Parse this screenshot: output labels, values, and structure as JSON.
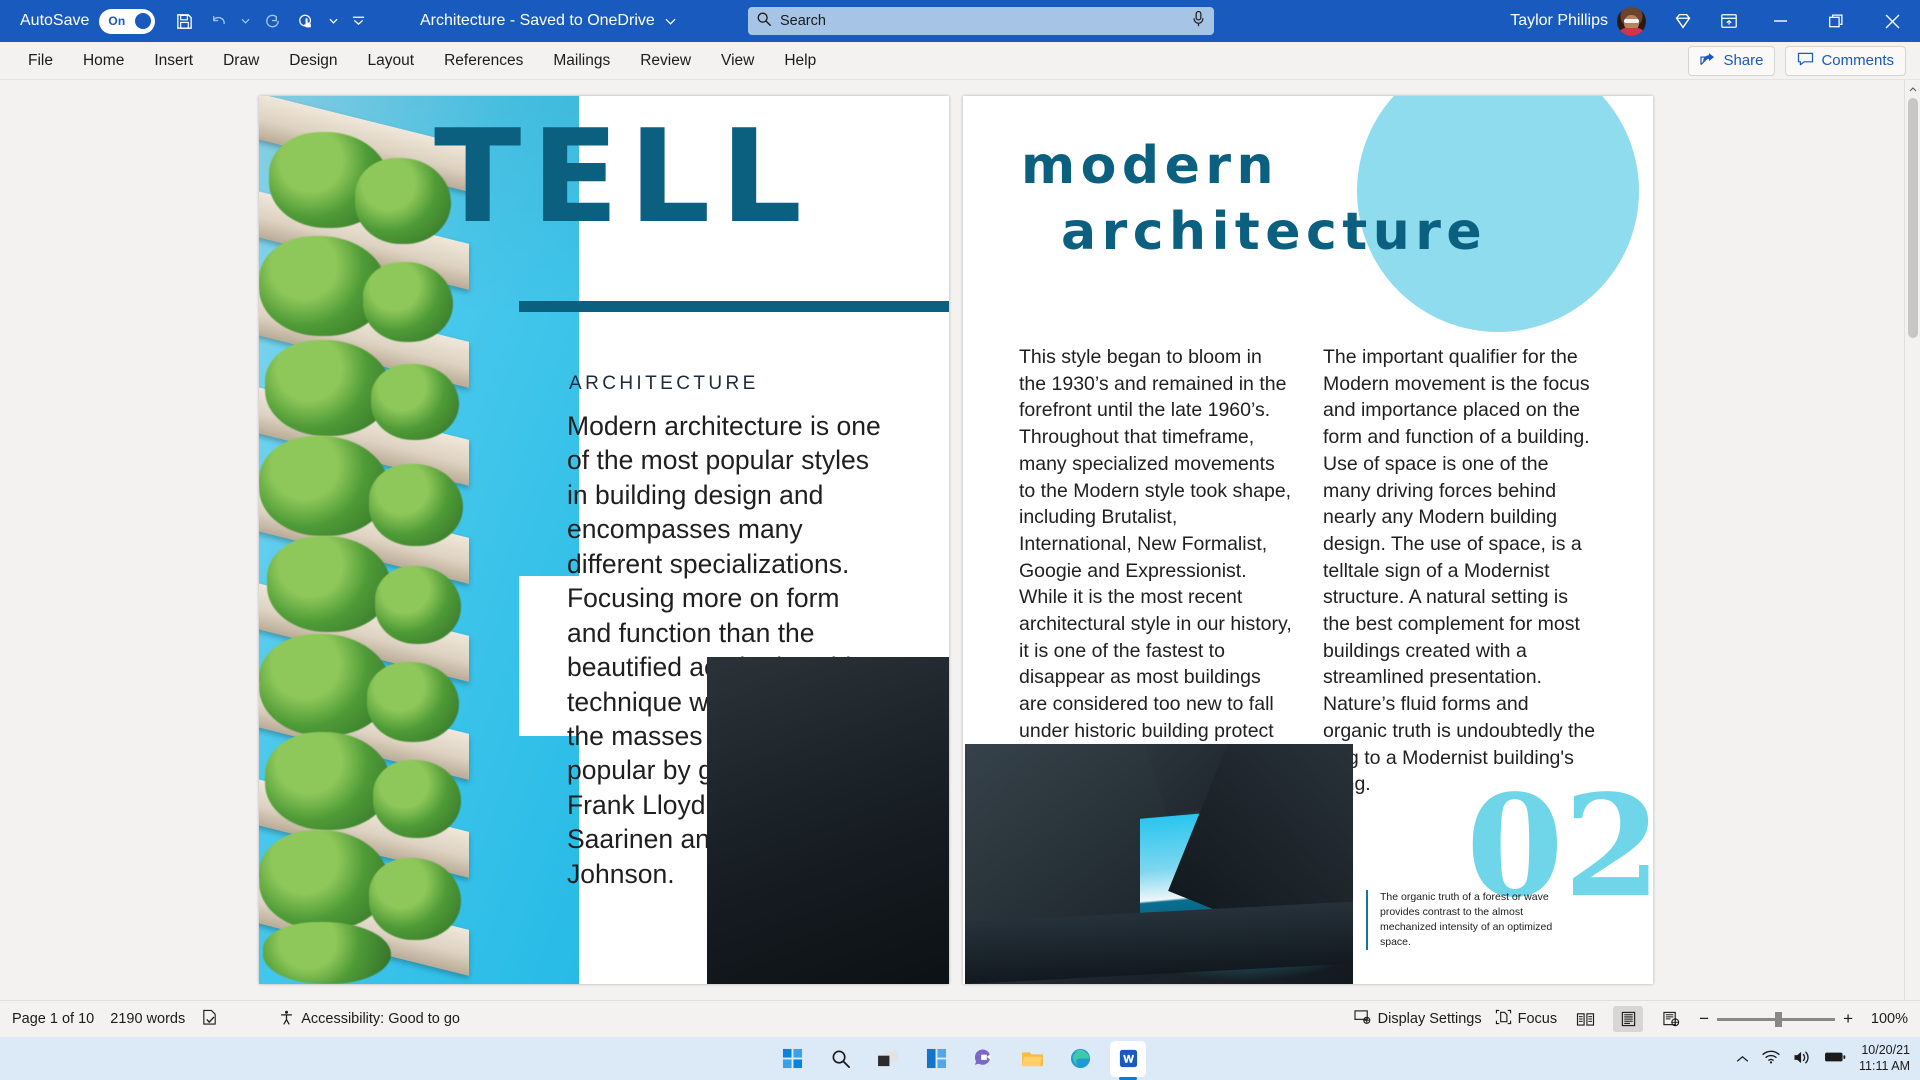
{
  "titlebar": {
    "autosave_label": "AutoSave",
    "autosave_state": "On",
    "doc_title": "Architecture - Saved to OneDrive",
    "user_name": "Taylor Phillips",
    "icons": [
      "save-icon",
      "undo-icon",
      "redo-icon",
      "touch-mode-icon",
      "customize-qat-icon"
    ],
    "window_controls": [
      "minimize",
      "restore",
      "close"
    ],
    "accent_color": "#185ABD"
  },
  "search": {
    "placeholder": "Search",
    "icon": "search-icon",
    "mic_icon": "microphone-icon"
  },
  "ribbon": {
    "tabs": [
      {
        "label": "File"
      },
      {
        "label": "Home"
      },
      {
        "label": "Insert"
      },
      {
        "label": "Draw"
      },
      {
        "label": "Design"
      },
      {
        "label": "Layout"
      },
      {
        "label": "References"
      },
      {
        "label": "Mailings"
      },
      {
        "label": "Review"
      },
      {
        "label": "View"
      },
      {
        "label": "Help"
      }
    ],
    "share_label": "Share",
    "comments_label": "Comments"
  },
  "document": {
    "left_page": {
      "title": "TELL",
      "subtitle": "ARCHITECTURE",
      "body": "Modern architecture is one of the most popular styles in building design and encompasses many different specializations. Focusing more on form and function than the beautified aesthetics, this technique was brought to the masses and made popular by greats like Frank Lloyd Wright, Eero Saarinen and Philip Johnson.",
      "image_alt": "green-vertical-garden-balconies-photo",
      "title_color": "#0B6080",
      "accent_color": "#63DDF7"
    },
    "right_page": {
      "title_line1": "modern",
      "title_line2": "architecture",
      "column1": "This style began to bloom in the 1930’s and remained in the forefront until the late 1960’s. Throughout that timeframe, many specialized movements to the Modern style took shape, including Brutalist, International, New Formalist, Googie and Expressionist. While it is the most recent architectural style in our history, it is one of the fastest to disappear as most buildings are considered too new to fall under historic building protect coverage.",
      "column2": "The important qualifier for the Modern movement is the focus and importance placed on the form and function of a building. Use of space is one of the many driving forces behind nearly any Modern building design. The use of space, is a telltale sign of a Modernist structure. A natural setting is the best complement for most buildings created with a streamlined presentation. Nature’s fluid forms and organic truth is undoubtedly the ying to a Modernist building's yang.",
      "page_number": "02",
      "caption": "The organic truth of a forest or wave provides contrast to the almost mechanized intensity of an optimized space.",
      "image_alt": "dark-concrete-architecture-opening-to-sky-and-sea",
      "title_color": "#0B6080",
      "circle_color": "#8FDCEE",
      "number_color": "#6FD5E8"
    }
  },
  "statusbar": {
    "page_info": "Page 1 of 10",
    "word_count": "2190 words",
    "proofing_icon": "proofing-icon",
    "accessibility": "Accessibility: Good to go",
    "display_settings": "Display Settings",
    "focus": "Focus",
    "views": [
      "read-mode-icon",
      "print-layout-icon",
      "web-layout-icon"
    ],
    "zoom_out": "−",
    "zoom_in": "+",
    "zoom_value": "100%"
  },
  "taskbar": {
    "apps": [
      {
        "name": "start-button"
      },
      {
        "name": "search-button"
      },
      {
        "name": "task-view-button"
      },
      {
        "name": "widgets-button"
      },
      {
        "name": "teams-chat-button"
      },
      {
        "name": "file-explorer-button"
      },
      {
        "name": "microsoft-edge-button"
      },
      {
        "name": "microsoft-word-button"
      }
    ],
    "tray": {
      "chevron": "show-hidden-icons",
      "wifi": "wifi-icon",
      "volume": "volume-icon",
      "battery": "battery-icon",
      "date": "10/20/21",
      "time": "11:11 AM"
    }
  }
}
